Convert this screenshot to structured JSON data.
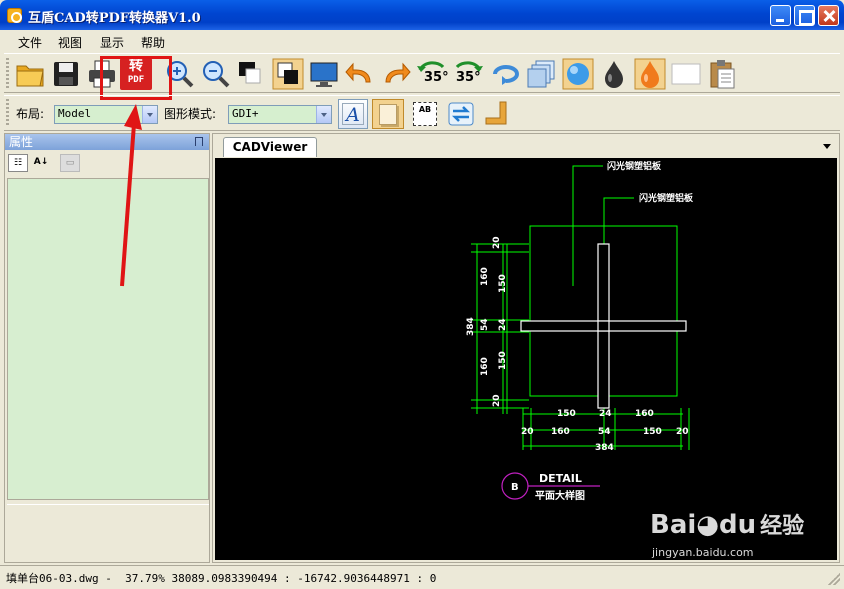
{
  "window": {
    "title": "互盾CAD转PDF转换器V1.0"
  },
  "menu": {
    "items": [
      "文件",
      "视图",
      "显示",
      "帮助"
    ]
  },
  "toolbar": {
    "convert_label_top": "转",
    "convert_label_bottom": "PDF",
    "rotate_left_label": "35°",
    "rotate_right_label": "35°"
  },
  "toolbar2": {
    "layout_label": "布局:",
    "layout_value": "Model",
    "render_mode_label": "图形模式:",
    "render_mode_value": "GDI+",
    "ab_label": "AB"
  },
  "left_panel": {
    "title": "属性"
  },
  "viewer": {
    "tab_label": "CADViewer"
  },
  "drawing": {
    "label_top": "闪光钢塑铝板",
    "label_right": "闪光钢塑铝板",
    "dims_left": [
      "20",
      "160",
      "24",
      "160",
      "20"
    ],
    "dims_inner_left": [
      "150",
      "54",
      "150"
    ],
    "dim_left_total": "384",
    "dims_bottom_upper": [
      "150",
      "24",
      "160"
    ],
    "dims_bottom_lower": [
      "20",
      "160",
      "54",
      "150",
      "20"
    ],
    "dim_bottom_total": "384",
    "detail_marker": "B",
    "detail_title": "DETAIL",
    "detail_subtitle": "平面大样图"
  },
  "status": {
    "file": "填单台06-03.dwg",
    "readout": "37.79% 38089.0983390494 : -16742.9036448971 : 0"
  },
  "watermark": {
    "brand": "Bai",
    "brand2": "du",
    "brand_cn": "经验",
    "url": "jingyan.baidu.com"
  },
  "colors": {
    "cad_line": "#00FF00",
    "cad_text": "#FFFFFF",
    "annotation_red": "#E01515",
    "title_blue": "#0045D0",
    "prop_green": "#D7EED0"
  }
}
